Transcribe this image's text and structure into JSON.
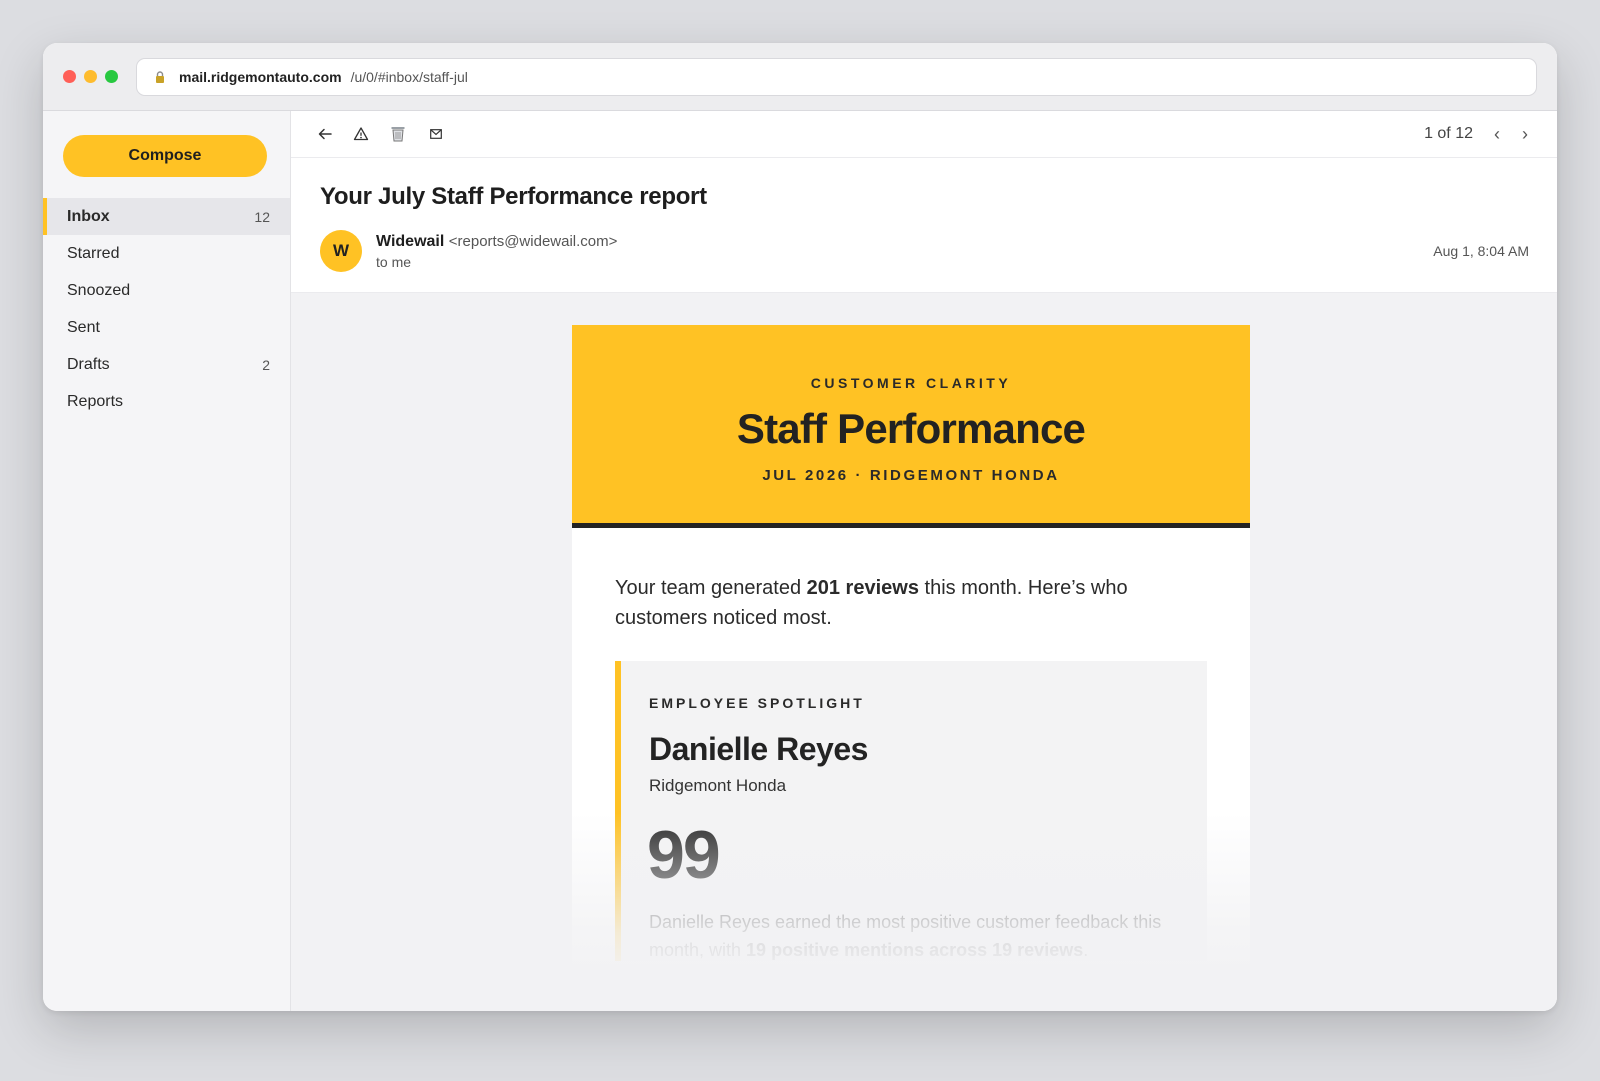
{
  "browser": {
    "url_host": "mail.ridgemontauto.com",
    "url_path": "/u/0/#inbox/staff-jul"
  },
  "sidebar": {
    "compose_label": "Compose",
    "items": [
      {
        "label": "Inbox",
        "count": "12",
        "active": true
      },
      {
        "label": "Starred",
        "count": ""
      },
      {
        "label": "Snoozed",
        "count": ""
      },
      {
        "label": "Sent",
        "count": ""
      },
      {
        "label": "Drafts",
        "count": "2"
      },
      {
        "label": "Reports",
        "count": ""
      }
    ]
  },
  "toolbar": {
    "icons": [
      "back-arrow-icon",
      "report-spam-icon",
      "trash-icon",
      "mark-unread-icon"
    ],
    "pager_text": "1 of 12",
    "prev_label": "‹",
    "next_label": "›"
  },
  "message": {
    "subject": "Your July Staff Performance report",
    "avatar_letter": "W",
    "sender_name": "Widewail",
    "sender_email": "<reports@widewail.com>",
    "to": "to me",
    "date": "Aug 1, 8:04 AM"
  },
  "email": {
    "eyebrow": "CUSTOMER CLARITY",
    "title": "Staff Performance",
    "subtitle": "JUL 2026 · RIDGEMONT HONDA",
    "intro_pre": "Your team generated ",
    "intro_bold": "201 reviews",
    "intro_post": " this month. Here’s who customers noticed most.",
    "spotlight": {
      "eyebrow": "EMPLOYEE SPOTLIGHT",
      "name": "Danielle Reyes",
      "dealer": "Ridgemont Honda",
      "score": "99",
      "desc_pre": "Danielle Reyes earned the most positive customer feedback this month, with ",
      "desc_bold": "19 positive mentions across 19 reviews",
      "desc_post": "."
    }
  },
  "colors": {
    "accent": "#ffc224",
    "dark_rule": "#232323",
    "content_bg": "#f2f2f4"
  }
}
